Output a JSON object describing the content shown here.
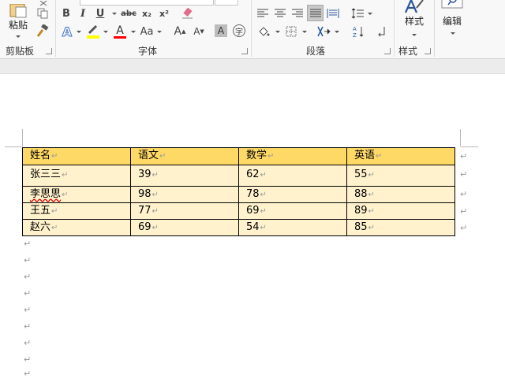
{
  "ribbon": {
    "clipboard": {
      "paste_label": "粘贴",
      "group_label": "剪贴板"
    },
    "font": {
      "group_label": "字体",
      "bold": "B",
      "italic": "I",
      "underline": "U",
      "strikethrough": "abc",
      "subscript": "x₂",
      "superscript": "x²",
      "text_effects": "A",
      "font_color": "A",
      "change_case": "Aa",
      "grow_font": "A",
      "shrink_font": "A",
      "char_shading": "A",
      "enclose_char": "字",
      "highlight_color": "#ffff00",
      "font_color_value": "#ff0000"
    },
    "paragraph": {
      "group_label": "段落"
    },
    "styles": {
      "styles_label": "样式",
      "group_label": "样式"
    },
    "editing": {
      "editing_label": "编辑"
    }
  },
  "table": {
    "headers": [
      "姓名",
      "语文",
      "数学",
      "英语"
    ],
    "rows": [
      [
        "张三三",
        "39",
        "62",
        "55"
      ],
      [
        "李思思",
        "98",
        "78",
        "88"
      ],
      [
        "王五",
        "77",
        "69",
        "89"
      ],
      [
        "赵六",
        "69",
        "54",
        "85"
      ]
    ],
    "colors": {
      "header_bg": "#ffd966",
      "row_bg": "#fff2cc"
    }
  },
  "marks": {
    "cell_end": "↵",
    "paragraph": "↵"
  }
}
